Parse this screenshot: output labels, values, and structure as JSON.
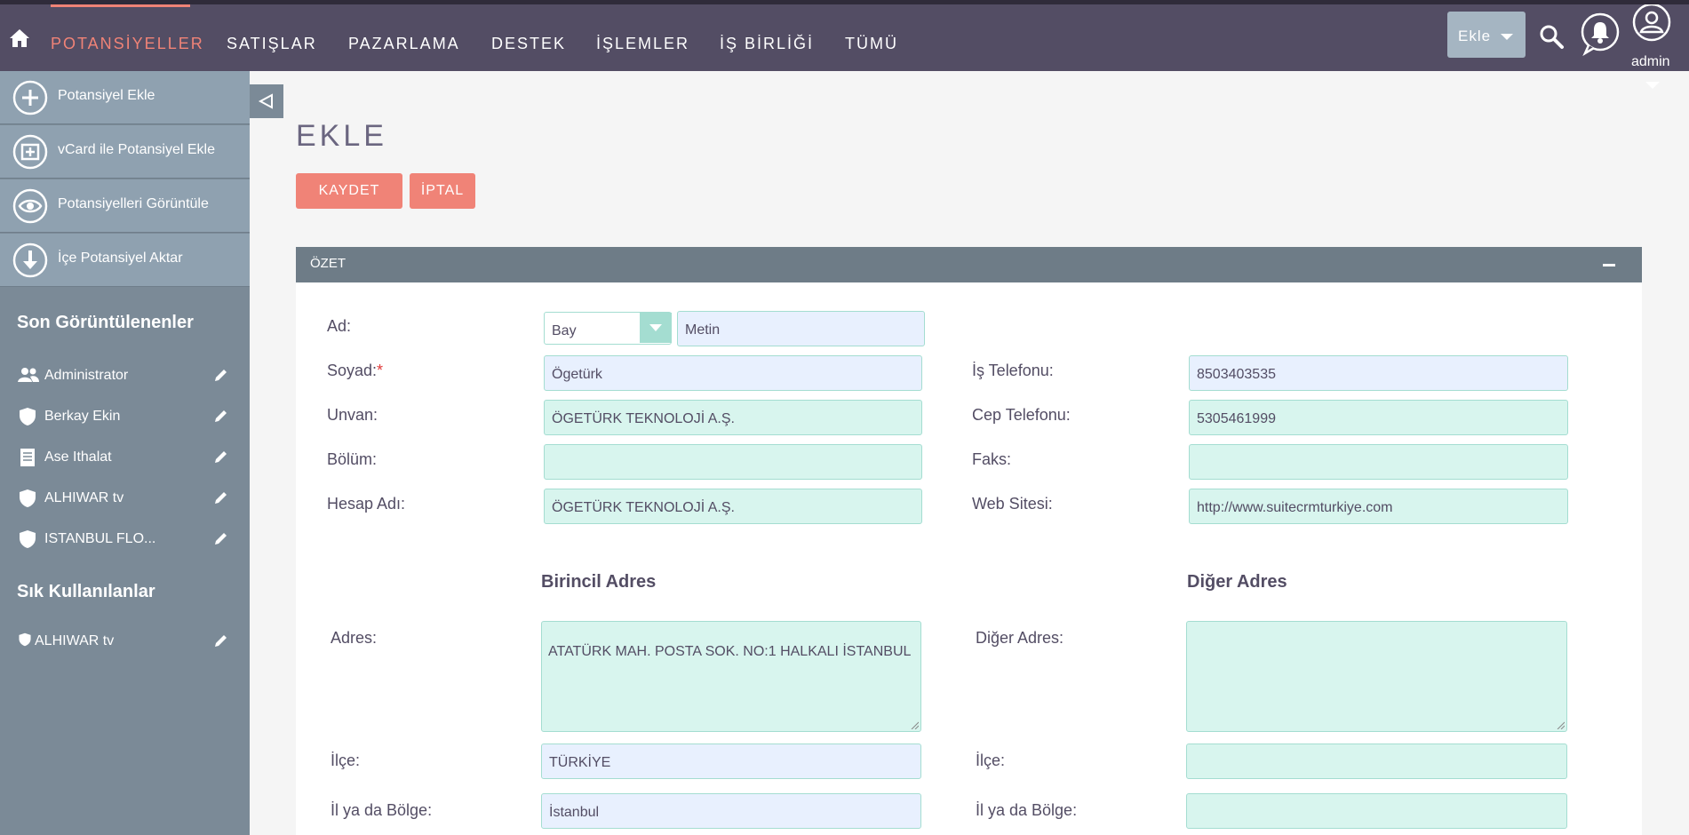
{
  "nav": {
    "items": [
      "POTANSİYELLER",
      "SATIŞLAR",
      "PAZARLAMA",
      "DESTEK",
      "İŞLEMLER",
      "İŞ BİRLİĞİ",
      "TÜMÜ"
    ],
    "add_label": "Ekle",
    "user_label": "admin",
    "accent": "#f08377"
  },
  "sidebar": {
    "actions": [
      "Potansiyel Ekle",
      "vCard ile Potansiyel Ekle",
      "Potansiyelleri Görüntüle",
      "İçe Potansiyel Aktar"
    ],
    "recent_heading": "Son Görüntülenenler",
    "recent": [
      "Administrator",
      "Berkay Ekin",
      "Ase Ithalat",
      "ALHIWAR tv",
      "ISTANBUL FLO..."
    ],
    "favorites_heading": "Sık Kullanılanlar",
    "favorites": [
      "ALHIWAR tv"
    ]
  },
  "page": {
    "title": "EKLE",
    "save_label": "KAYDET",
    "cancel_label": "İPTAL",
    "panel_title": "ÖZET"
  },
  "form": {
    "ad_label": "Ad:",
    "salutation": "Bay",
    "first_name": "Metin",
    "soyad_label": "Soyad:",
    "required_mark": "*",
    "last_name": "Ögetürk",
    "unvan_label": "Unvan:",
    "unvan": "ÖGETÜRK TEKNOLOJİ A.Ş.",
    "bolum_label": "Bölüm:",
    "bolum": "",
    "hesap_label": "Hesap Adı:",
    "hesap": "ÖGETÜRK TEKNOLOJİ A.Ş.",
    "is_tel_label": "İş Telefonu:",
    "is_tel": "8503403535",
    "cep_label": "Cep Telefonu:",
    "cep": "5305461999",
    "faks_label": "Faks:",
    "faks": "",
    "web_label": "Web Sitesi:",
    "web": "http://www.suitecrmturkiye.com",
    "primary_heading": "Birincil Adres",
    "other_heading": "Diğer Adres",
    "adres_label": "Adres:",
    "adres": "ATATÜRK MAH. POSTA SOK. NO:1 HALKALI İSTANBUL",
    "diger_adres_label": "Diğer Adres:",
    "diger_adres": "",
    "ilce_label": "İlçe:",
    "ilce": "TÜRKİYE",
    "diger_ilce": "",
    "il_label": "İl ya da Bölge:",
    "il": "İstanbul",
    "diger_il": ""
  }
}
